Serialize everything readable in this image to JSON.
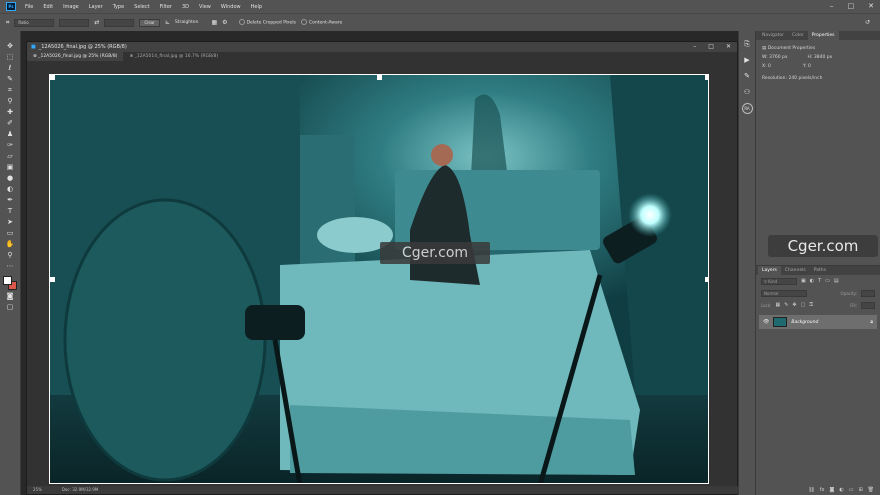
{
  "menubar": {
    "logo": "Ps",
    "items": [
      "File",
      "Edit",
      "Image",
      "Layer",
      "Type",
      "Select",
      "Filter",
      "3D",
      "View",
      "Window",
      "Help"
    ]
  },
  "optionsbar": {
    "ratio_label": "Ratio",
    "clear_label": "Clear",
    "straighten_label": "Straighten",
    "delete_cropped_label": "Delete Cropped Pixels",
    "content_aware_label": "Content-Aware"
  },
  "document": {
    "title": "_12A5026_final.jpg @ 25% (RGB/8)",
    "tabs": [
      {
        "label": "_12A5026_final.jpg @ 25% (RGB/8)"
      },
      {
        "label": "_12A5014_final.jpg @ 16.7% (RGB/8)"
      }
    ],
    "status_zoom": "25%",
    "status_doc": "Doc: 32.9M/32.9M"
  },
  "properties": {
    "tabs": [
      "Navigator",
      "Color",
      "Properties"
    ],
    "heading": "Document Properties",
    "w_label": "W:",
    "w_value": "3760 px",
    "h_label": "H:",
    "h_value": "3840 px",
    "x_label": "X:",
    "x_value": "0",
    "y_label": "Y:",
    "y_value": "0",
    "resolution": "Resolution: 240 pixels/inch"
  },
  "watermark": {
    "canvas_text": "Cger.com",
    "panel_text": "Cger.com"
  },
  "layers": {
    "tabs": [
      "Layers",
      "Channels",
      "Paths"
    ],
    "kind_placeholder": "Kind",
    "blend_mode": "Normal",
    "opacity_label": "Opacity:",
    "fill_label": "Fill:",
    "layer_name": "Background"
  },
  "colors": {
    "scene_dark": "#0b2f33",
    "scene_mid": "#1f6a6f",
    "scene_light": "#4a9ba0",
    "bg_swatch": "#d9574b"
  }
}
